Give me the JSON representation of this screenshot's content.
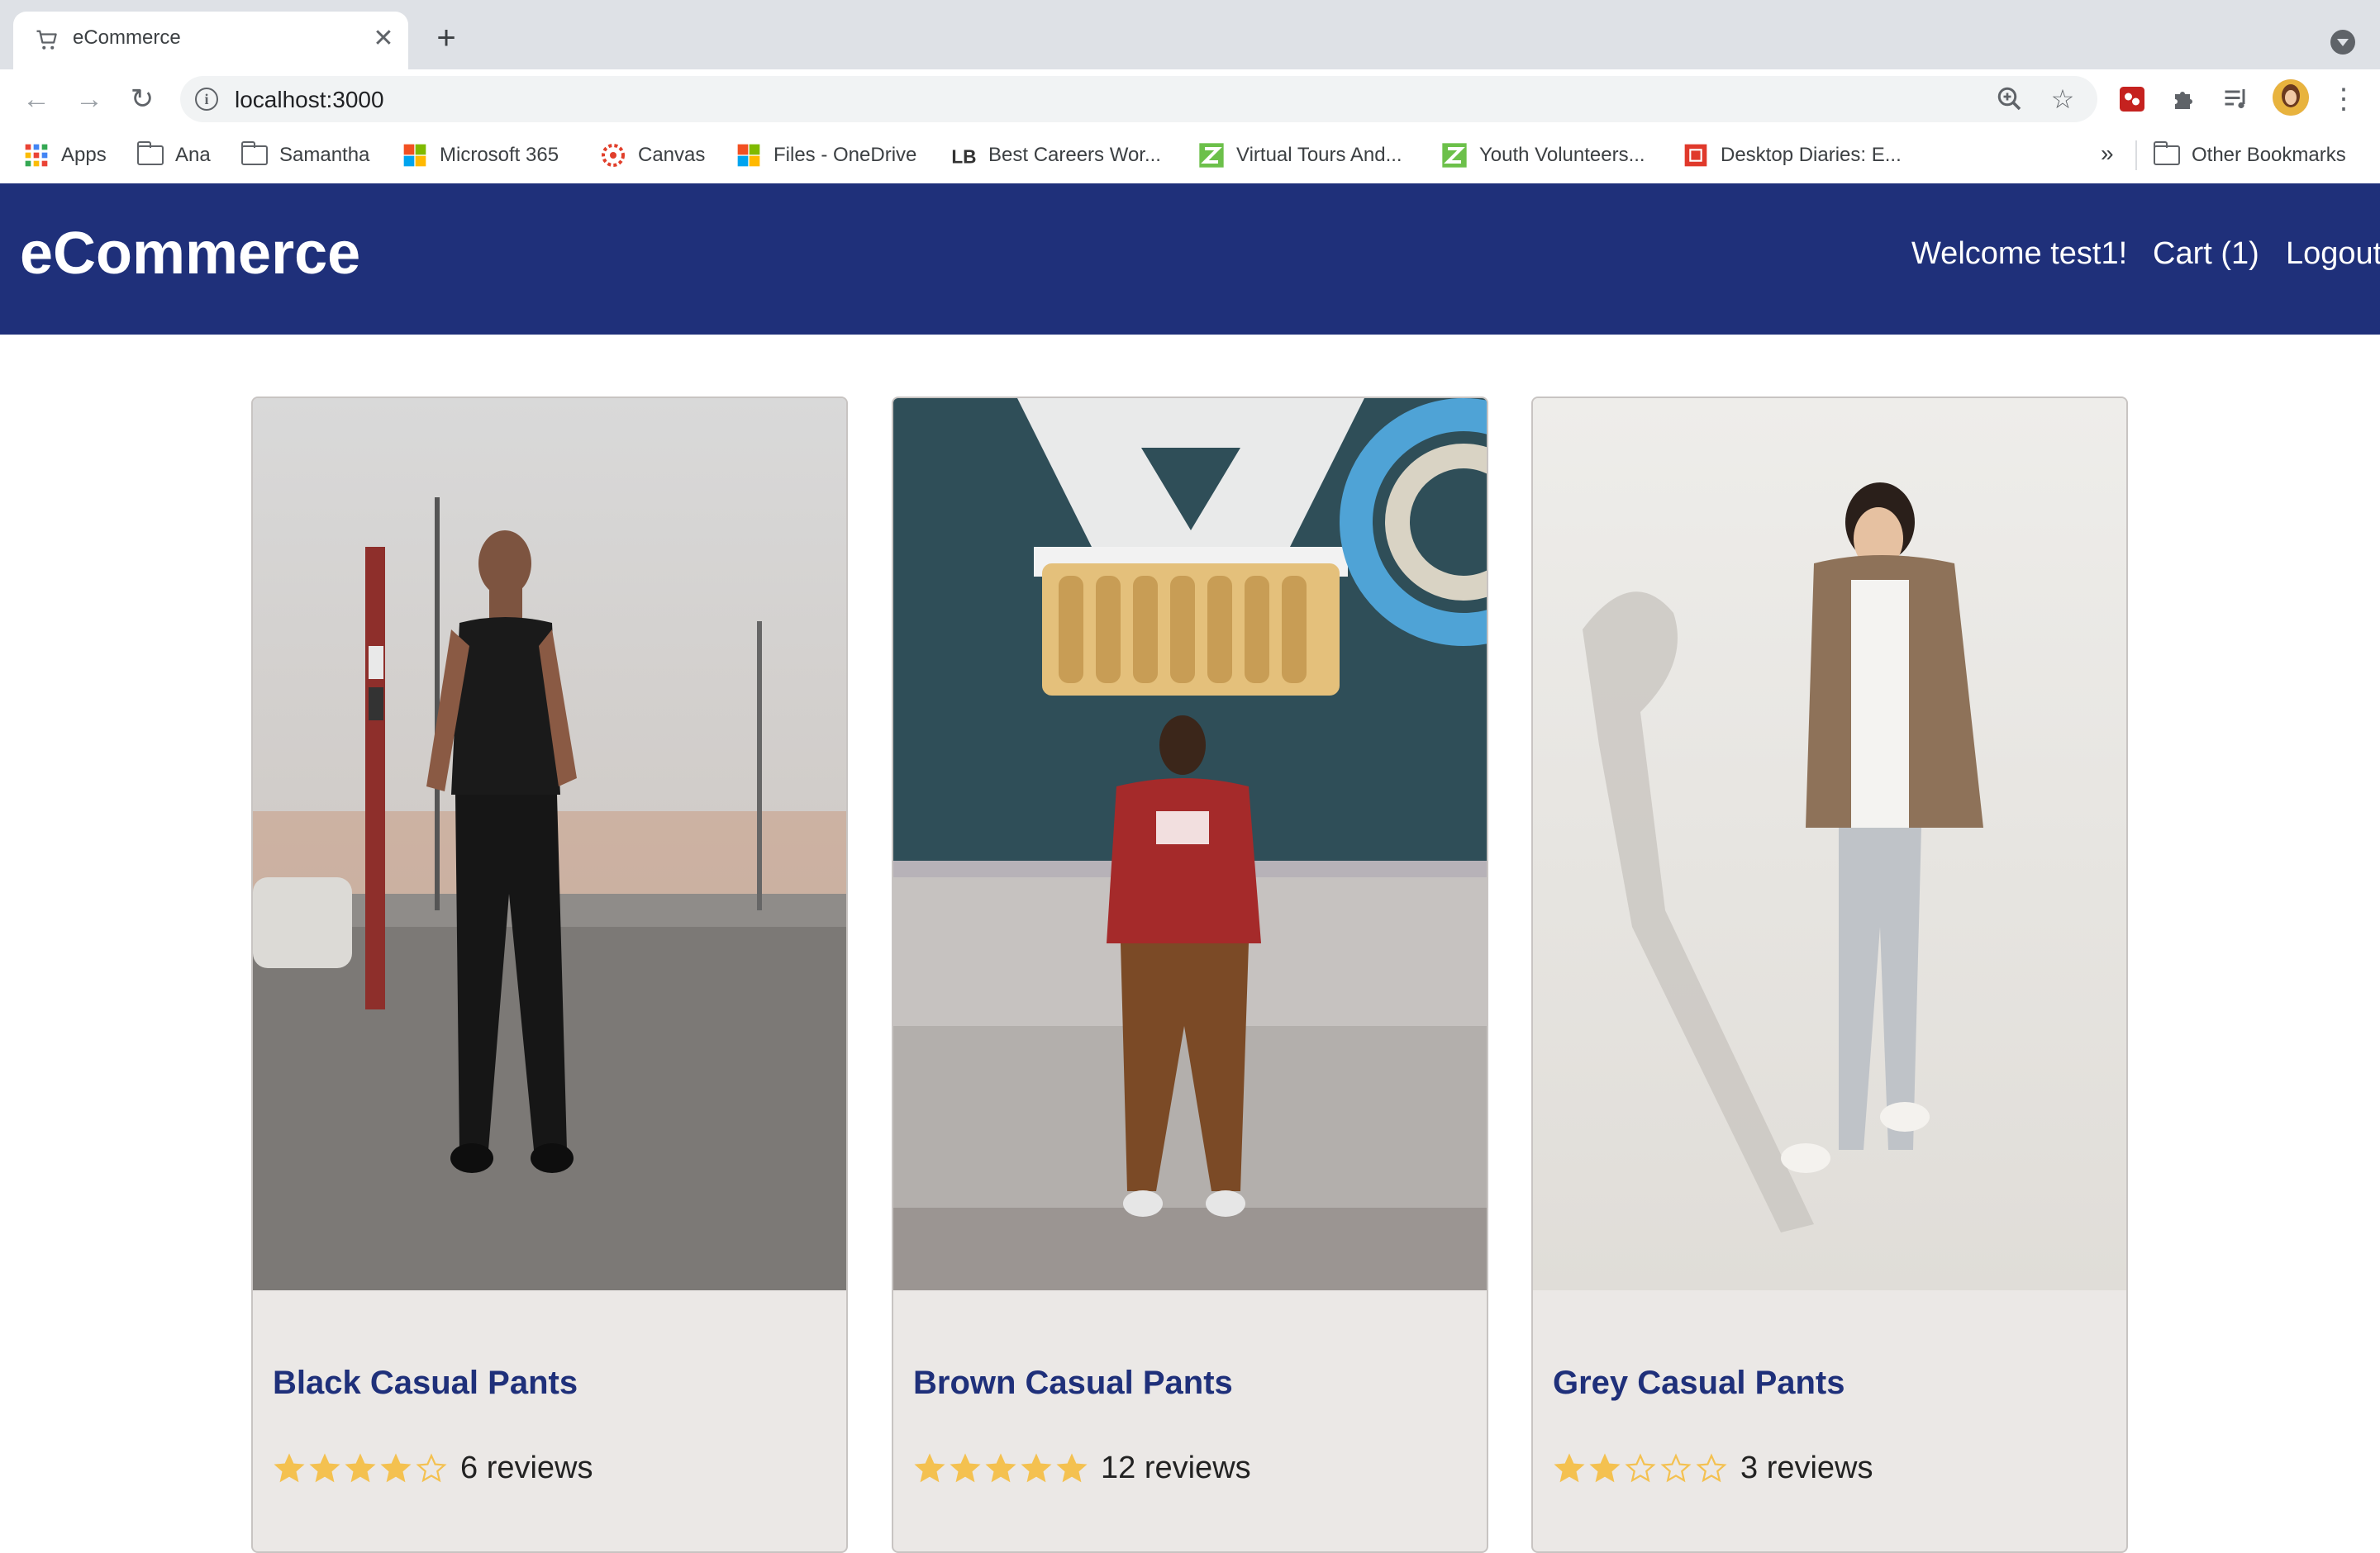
{
  "browser": {
    "tab_title": "eCommerce",
    "url": "localhost:3000",
    "bookmarks": [
      {
        "label": "Apps",
        "icon": "apps-grid-icon"
      },
      {
        "label": "Ana",
        "icon": "folder-icon"
      },
      {
        "label": "Samantha",
        "icon": "folder-icon"
      },
      {
        "label": "Microsoft 365",
        "icon": "microsoft-icon"
      },
      {
        "label": "Canvas",
        "icon": "canvas-icon"
      },
      {
        "label": "Files - OneDrive",
        "icon": "microsoft-icon"
      },
      {
        "label": "Best Careers Wor...",
        "icon": "lb-icon"
      },
      {
        "label": "Virtual Tours And...",
        "icon": "z-icon"
      },
      {
        "label": "Youth Volunteers...",
        "icon": "z-icon"
      },
      {
        "label": "Desktop Diaries: E...",
        "icon": "red-square-icon"
      }
    ],
    "more_bookmarks": "»",
    "other_bookmarks": "Other Bookmarks"
  },
  "header": {
    "brand": "eCommerce",
    "welcome": "Welcome test1!",
    "cart": "Cart (1)",
    "logout": "Logout"
  },
  "products": [
    {
      "name": "Black Casual Pants",
      "rating": 4,
      "max_rating": 5,
      "reviews": "6 reviews"
    },
    {
      "name": "Brown Casual Pants",
      "rating": 5,
      "max_rating": 5,
      "reviews": "12 reviews"
    },
    {
      "name": "Grey Casual Pants",
      "rating": 2,
      "max_rating": 5,
      "reviews": "3 reviews"
    }
  ],
  "colors": {
    "header_bg": "#1f307a",
    "title": "#1f307a",
    "star_filled": "#f4c150",
    "star_empty": "#f4c150",
    "card_bg": "#ebe8e6"
  }
}
